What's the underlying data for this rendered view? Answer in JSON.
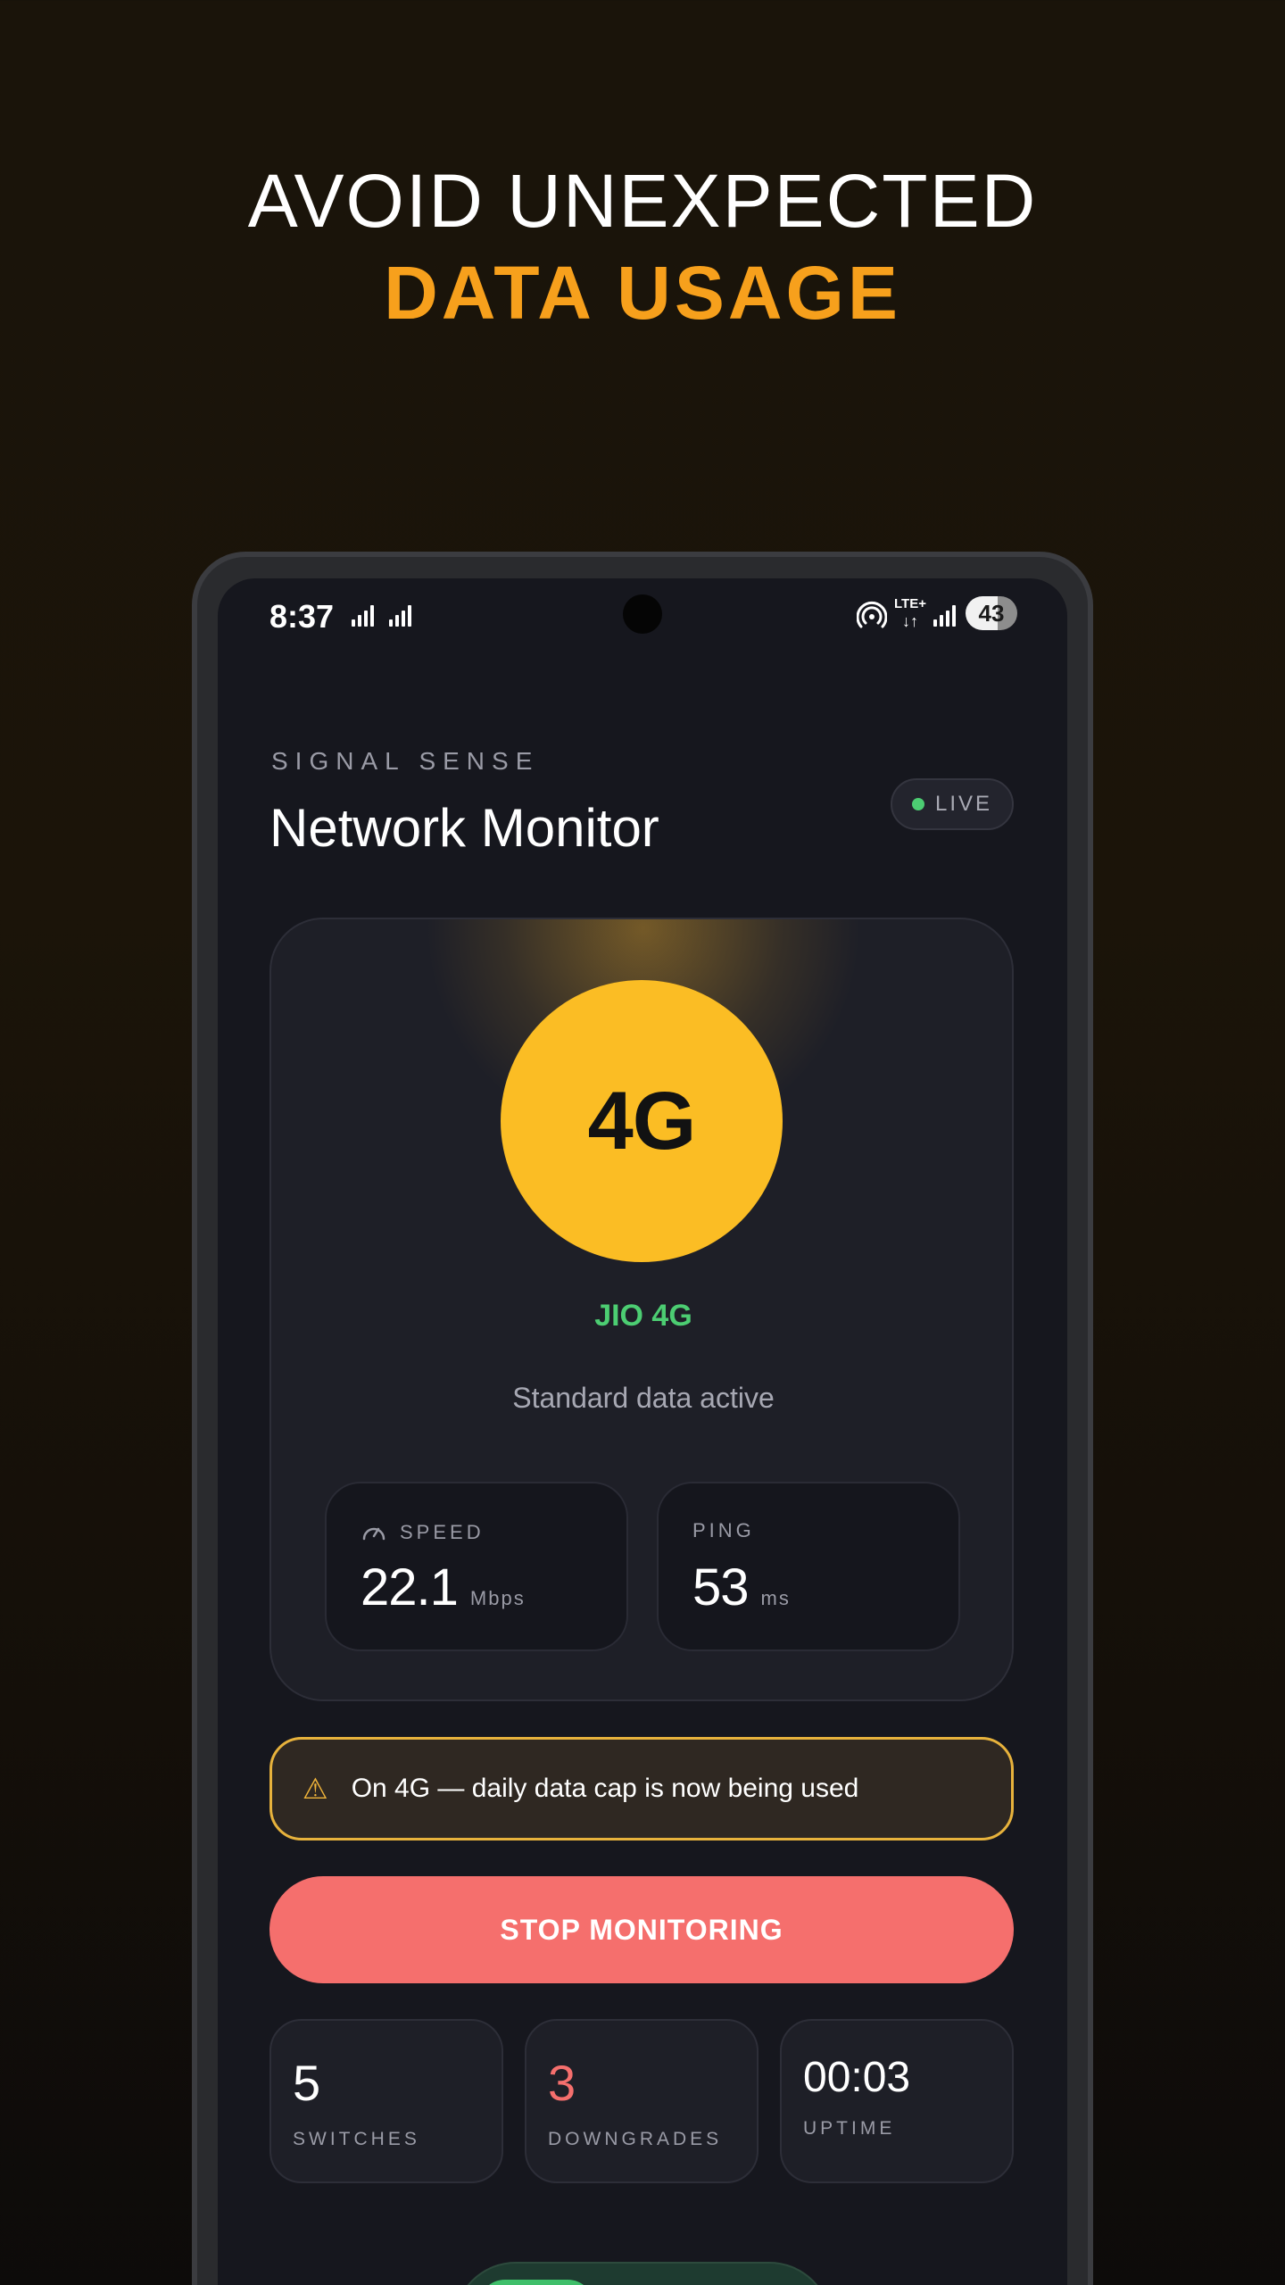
{
  "headline": {
    "line1": "AVOID UNEXPECTED",
    "line2": "DATA USAGE"
  },
  "status_bar": {
    "time": "8:37",
    "network_label": "LTE+",
    "network_arrows": "↓↑",
    "battery_level": "43"
  },
  "app": {
    "kicker": "SIGNAL SENSE",
    "title": "Network Monitor",
    "live_label": "LIVE"
  },
  "network_card": {
    "network_type": "4G",
    "carrier": "JIO 4G",
    "status": "Standard data active",
    "speed": {
      "label": "SPEED",
      "value": "22.1",
      "unit": "Mbps"
    },
    "ping": {
      "label": "PING",
      "value": "53",
      "unit": "ms"
    }
  },
  "warning": {
    "icon": "⚠",
    "text": "On 4G — daily data cap is now being used"
  },
  "actions": {
    "stop_label": "STOP MONITORING"
  },
  "stats": {
    "switches": {
      "value": "5",
      "label": "SWITCHES"
    },
    "downgrades": {
      "value": "3",
      "label": "DOWNGRADES"
    },
    "uptime": {
      "value": "00:03",
      "label": "UPTIME"
    }
  },
  "colors": {
    "accent": "#f7a01c",
    "network_badge": "#fbbd24",
    "success": "#4ccd72",
    "danger": "#f56f6d",
    "warning_border": "#e7b23c"
  }
}
